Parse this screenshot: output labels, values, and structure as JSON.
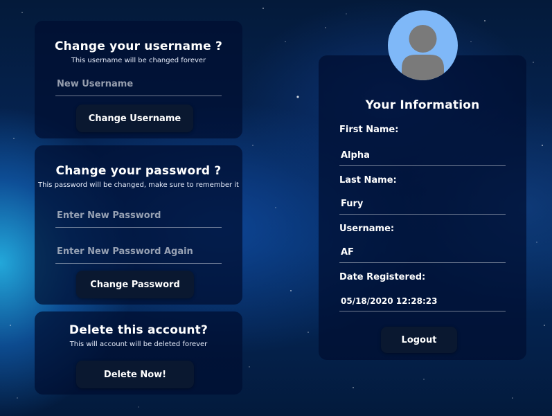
{
  "change_username": {
    "title": "Change your username ?",
    "subtitle": "This username will be changed forever",
    "input_placeholder": "New Username",
    "input_value": "",
    "button_label": "Change Username"
  },
  "change_password": {
    "title": "Change your password ?",
    "subtitle": "This password will be changed, make sure to remember it",
    "new_password_placeholder": "Enter New Password",
    "new_password_value": "",
    "confirm_password_placeholder": "Enter New Password Again",
    "confirm_password_value": "",
    "button_label": "Change Password"
  },
  "delete_account": {
    "title": "Delete this account?",
    "subtitle": "This will account will be deleted forever",
    "button_label": "Delete Now!"
  },
  "info": {
    "avatar_icon": "user-avatar-icon",
    "title": "Your Information",
    "fields": [
      {
        "label": "First Name:",
        "value": "Alpha"
      },
      {
        "label": "Last Name:",
        "value": "Fury"
      },
      {
        "label": "Username:",
        "value": "AF"
      },
      {
        "label": "Date Registered:",
        "value": "05/18/2020 12:28:23"
      }
    ],
    "logout_label": "Logout"
  },
  "colors": {
    "avatar_bg": "#7fb8f8",
    "avatar_fg": "#7a7a7a",
    "card_bg": "#000e30",
    "button_bg": "#0a1830"
  }
}
